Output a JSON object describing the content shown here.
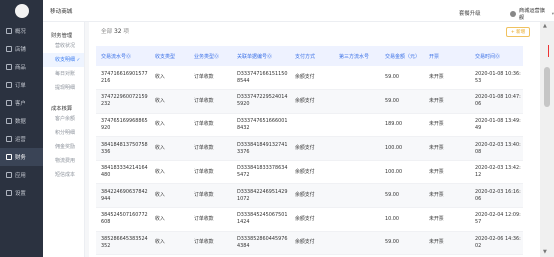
{
  "brand": "移动商城",
  "topbar": {
    "upgrade": "套餐升级",
    "user": "商城运营旗舰"
  },
  "nav": [
    {
      "label": "概况"
    },
    {
      "label": "店铺"
    },
    {
      "label": "商品"
    },
    {
      "label": "订单"
    },
    {
      "label": "客户"
    },
    {
      "label": "数据"
    },
    {
      "label": "运营"
    },
    {
      "label": "财务",
      "active": true
    },
    {
      "label": "应用"
    },
    {
      "label": "设置"
    }
  ],
  "submenu": {
    "group1": "财务管理",
    "items1": [
      "营收状况",
      "收支明细",
      "每日对账",
      "提现明细"
    ],
    "group2": "成本核算",
    "items2": [
      "客户余额",
      "积分明细",
      "佣金奖励",
      "物流费用",
      "短信成本"
    ],
    "active": "收支明细"
  },
  "summary": {
    "prefix": "全部",
    "count": "32",
    "suffix": "项"
  },
  "add_button": "+ 新增",
  "table": {
    "headers": [
      "交易流水号⓪",
      "收支类型",
      "业务类型⓪",
      "关联单据编号⓪",
      "支付方式",
      "第三方流水号",
      "交易金额（元）",
      "开票",
      "交易时间⓪"
    ],
    "rows": [
      [
        "374716616901577216",
        "收入",
        "订单收款",
        "D3337471661511508544",
        "余额支付",
        "",
        "59.00",
        "未开票",
        "2020-01-08 10:36:53"
      ],
      [
        "374722960072159232",
        "收入",
        "订单收款",
        "D3337472295240145920",
        "余额支付",
        "",
        "59.00",
        "未开票",
        "2020-01-08 10:47:06"
      ],
      [
        "374765169968865920",
        "收入",
        "订单收款",
        "D3337476516660018432",
        "",
        "",
        "189.00",
        "未开票",
        "2020-01-08 13:49:49"
      ],
      [
        "384184813750758336",
        "收入",
        "订单收款",
        "D3338418491327413376",
        "余额支付",
        "",
        "100.00",
        "未开票",
        "2020-02-03 13:40:08"
      ],
      [
        "384183334214164480",
        "收入",
        "订单收款",
        "D3338418333786345472",
        "余额支付",
        "",
        "100.00",
        "未开票",
        "2020-02-03 13:42:12"
      ],
      [
        "384224690637842944",
        "收入",
        "订单收款",
        "D3338422469514291072",
        "余额支付",
        "",
        "59.00",
        "未开票",
        "2020-02-03 16:16:06"
      ],
      [
        "384524507160772608",
        "收入",
        "订单收款",
        "D3338452450675011424",
        "余额支付",
        "",
        "10.00",
        "未开票",
        "2020-02-04 12:09:57"
      ],
      [
        "385286645383524352",
        "收入",
        "订单收款",
        "D3338528604459764384",
        "余额支付",
        "",
        "59.00",
        "未开票",
        "2020-02-06 14:36:02"
      ]
    ]
  }
}
